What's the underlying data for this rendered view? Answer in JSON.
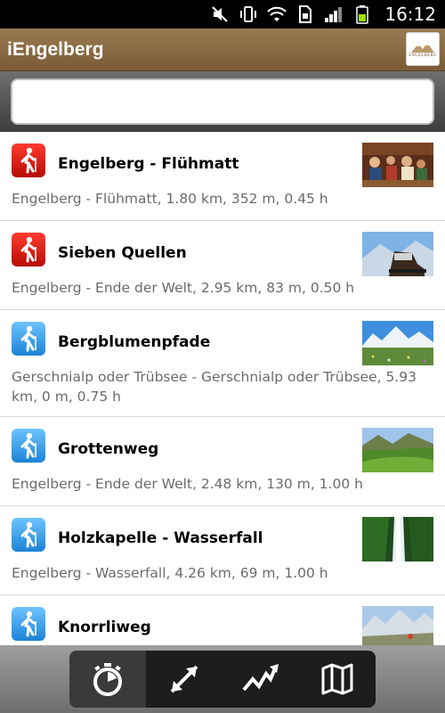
{
  "status_bar": {
    "time": "16:12"
  },
  "app": {
    "title": "iEngelberg",
    "logo_text": "ENGELBERG"
  },
  "search": {
    "placeholder": "",
    "value": ""
  },
  "list": {
    "items": [
      {
        "name": "Engelberg - Flühmatt",
        "desc": "Engelberg - Flühmatt, 1.80 km, 352 m, 0.45 h",
        "color": "red",
        "icon": "hiker-icon",
        "thumb": "restaurant"
      },
      {
        "name": "Sieben Quellen",
        "desc": "Engelberg - Ende der Welt, 2.95 km, 83 m, 0.50 h",
        "color": "red",
        "icon": "hiker-icon",
        "thumb": "boots"
      },
      {
        "name": "Bergblumenpfade",
        "desc": "Gerschnialp oder Trübsee - Gerschnialp oder Trübsee, 5.93 km, 0 m, 0.75 h",
        "color": "blue",
        "icon": "hiker-icon",
        "thumb": "mountains"
      },
      {
        "name": "Grottenweg",
        "desc": "Engelberg - Ende der Welt, 2.48 km, 130 m, 1.00 h",
        "color": "blue",
        "icon": "hiker-icon",
        "thumb": "valley"
      },
      {
        "name": "Holzkapelle -  Wasserfall",
        "desc": "Engelberg - Wasserfall, 4.26 km, 69 m, 1.00 h",
        "color": "blue",
        "icon": "hiker-icon",
        "thumb": "waterfall"
      },
      {
        "name": "Knorrliweg",
        "desc": "",
        "color": "blue",
        "icon": "hiker-icon",
        "thumb": "peaks"
      }
    ]
  },
  "toolbar": {
    "buttons": [
      {
        "icon": "stopwatch-icon",
        "active": true
      },
      {
        "icon": "distance-arrows-icon",
        "active": false
      },
      {
        "icon": "elevation-icon",
        "active": false
      },
      {
        "icon": "map-icon",
        "active": false
      }
    ]
  },
  "colors": {
    "accent_red": "#d81a10",
    "accent_blue": "#2f95e6",
    "header_brown": "#8a6a44"
  }
}
